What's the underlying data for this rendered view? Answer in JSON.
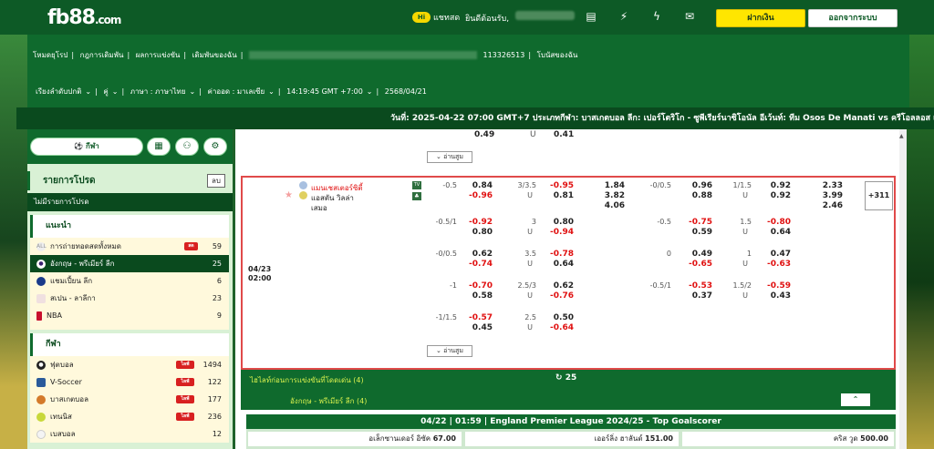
{
  "brand": {
    "name": "fb88",
    "suffix": ".com"
  },
  "topbar": {
    "chat_label": "แชทสด",
    "chat_icon_text": "Hi",
    "welcome": "ยินดีต้อนรับ,",
    "deposit_label": "ฝากเงิน",
    "logout_label": "ออกจากระบบ"
  },
  "nav": {
    "row1": [
      "โหมดยุโรป",
      "|",
      "กฎการเดิมพัน",
      "|",
      "ผลการแข่งขัน",
      "|",
      "เดิมพันของฉัน",
      "|",
      "113326513",
      "|",
      "โบนัสของฉัน"
    ],
    "row2": [
      "เรียงลำดับปกติ",
      "⌄",
      "|",
      "คู่",
      "⌄",
      "|",
      "ภาษา : ภาษาไทย",
      "⌄",
      "|",
      "ค่าออด : มาเลเซีย",
      "⌄",
      "|",
      "14:19:45 GMT +7:00",
      "⌄",
      "|",
      "2568/04/21"
    ]
  },
  "ticker": "วันที่: 2025-04-22 07:00 GMT+7 ประเภทกีฬา: บาสเกตบอล ลีก: เปอร์โตริโก - ซูพีเรียร์นาซิโอนัล อีเว้นท์: ทีม Osos De Manati vs ครีโอลลอส เด",
  "sidebar": {
    "sport_btn": "กีฬา",
    "mylist_title": "รายการโปรด",
    "delete_label": "ลบ",
    "no_fav": "ไม่มีรายการโปรด",
    "recommend_title": "แนะนำ",
    "recommend": [
      {
        "label": "การถ่ายทอดสดทั้งหมด",
        "count": "59",
        "live": "สด"
      },
      {
        "label": "อังกฤษ - พรีเมียร์ ลีก",
        "count": "25",
        "active": true
      },
      {
        "label": "แชมเปี้ยน ลีก",
        "count": "6"
      },
      {
        "label": "สเปน - ลาลีกา",
        "count": "23"
      },
      {
        "label": "NBA",
        "count": "9"
      }
    ],
    "sports_title": "กีฬา",
    "sports": [
      {
        "label": "ฟุตบอล",
        "count": "1494",
        "live": "ไลฟ์"
      },
      {
        "label": "V-Soccer",
        "count": "122",
        "live": "ไลฟ์"
      },
      {
        "label": "บาสเกตบอล",
        "count": "177",
        "live": "ไลฟ์"
      },
      {
        "label": "เทนนิส",
        "count": "236",
        "live": "ไลฟ์"
      },
      {
        "label": "เบสบอล",
        "count": "12"
      }
    ]
  },
  "main": {
    "top_odds": {
      "home": "0.49",
      "mid": "U",
      "away": "0.41"
    },
    "more_label": "อ่านสูม",
    "match": {
      "date": "04/23",
      "time": "02:00",
      "home": "แมนเชสเตอร์ซิตี้",
      "away": "แอสตัน วิลล่า",
      "draw": "เสมอ",
      "plus": "+311",
      "rows": [
        {
          "fh": "-0.5",
          "fh1": "0.84",
          "fh2": "-0.96",
          "ou": "3/3.5",
          "ou1": "-0.95",
          "ou2": "0.81",
          "x1": "1.84",
          "x2": "3.82",
          "x3": "4.06",
          "h2h": "-0/0.5",
          "h21": "0.96",
          "h22": "0.88",
          "ou2h": "1/1.5",
          "ou21": "0.92",
          "ou22": "0.92",
          "y1": "2.33",
          "y2": "3.99",
          "y3": "2.46"
        },
        {
          "fh": "-0.5/1",
          "fh1": "-0.92",
          "fh2": "0.80",
          "ou": "3",
          "ou1": "0.80",
          "ou2": "-0.94",
          "h2h": "-0.5",
          "h21": "-0.75",
          "h22": "0.59",
          "ou2h": "1.5",
          "ou21": "-0.80",
          "ou22": "0.64"
        },
        {
          "fh": "-0/0.5",
          "fh1": "0.62",
          "fh2": "-0.74",
          "ou": "3.5",
          "ou1": "-0.78",
          "ou2": "0.64",
          "h2h": "0",
          "h21": "0.49",
          "h22": "-0.65",
          "ou2h": "1",
          "ou21": "0.47",
          "ou22": "-0.63"
        },
        {
          "fh": "-1",
          "fh1": "-0.70",
          "fh2": "0.58",
          "ou": "2.5/3",
          "ou1": "0.62",
          "ou2": "-0.76",
          "h2h": "-0.5/1",
          "h21": "-0.53",
          "h22": "0.37",
          "ou2h": "1.5/2",
          "ou21": "-0.59",
          "ou22": "0.43"
        },
        {
          "fh": "-1/1.5",
          "fh1": "-0.57",
          "fh2": "0.45",
          "ou": "2.5",
          "ou1": "0.50",
          "ou2": "-0.64"
        }
      ],
      "u": "U"
    },
    "highlight_bar": "ไฮไลท์ก่อนการแข่งขันที่โดดเด่น (4)",
    "refresh_count": "25",
    "league_bar": "อังกฤษ - พรีเมียร์ ลีก (4)",
    "scorer_title": "04/22 | 01:59 | England Premier League 2024/25 - Top Goalscorer",
    "scorers": [
      {
        "name": "อเล็กซานเดอร์ อิซัค",
        "odds": "67.00"
      },
      {
        "name": "เออร์ลิ่ง ฮาลันด์",
        "odds": "151.00"
      },
      {
        "name": "คริส วูด",
        "odds": "500.00"
      }
    ]
  }
}
